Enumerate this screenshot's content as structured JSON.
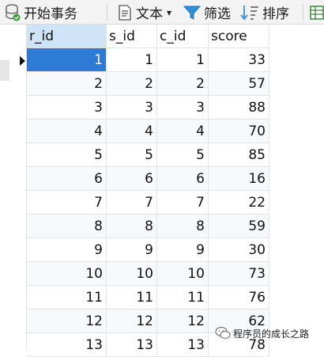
{
  "toolbar": {
    "begin_transaction": "开始事务",
    "text": "文本",
    "text_dropdown_glyph": "▾",
    "filter": "筛选",
    "sort": "排序"
  },
  "grid": {
    "columns": [
      "r_id",
      "s_id",
      "c_id",
      "score"
    ],
    "selected_row": 0,
    "rows": [
      [
        "1",
        "1",
        "1",
        "33"
      ],
      [
        "2",
        "2",
        "2",
        "57"
      ],
      [
        "3",
        "3",
        "3",
        "88"
      ],
      [
        "4",
        "4",
        "4",
        "70"
      ],
      [
        "5",
        "5",
        "5",
        "85"
      ],
      [
        "6",
        "6",
        "6",
        "16"
      ],
      [
        "7",
        "7",
        "7",
        "22"
      ],
      [
        "8",
        "8",
        "8",
        "59"
      ],
      [
        "9",
        "9",
        "9",
        "30"
      ],
      [
        "10",
        "10",
        "10",
        "73"
      ],
      [
        "11",
        "11",
        "11",
        "76"
      ],
      [
        "12",
        "12",
        "12",
        "62"
      ],
      [
        "13",
        "13",
        "13",
        "78"
      ]
    ]
  },
  "watermark": {
    "text": "程序员的成长之路"
  },
  "colors": {
    "selection": "#2e7bd6",
    "header_selected": "#cfe4f7",
    "alt_row": "#f7fafd"
  }
}
